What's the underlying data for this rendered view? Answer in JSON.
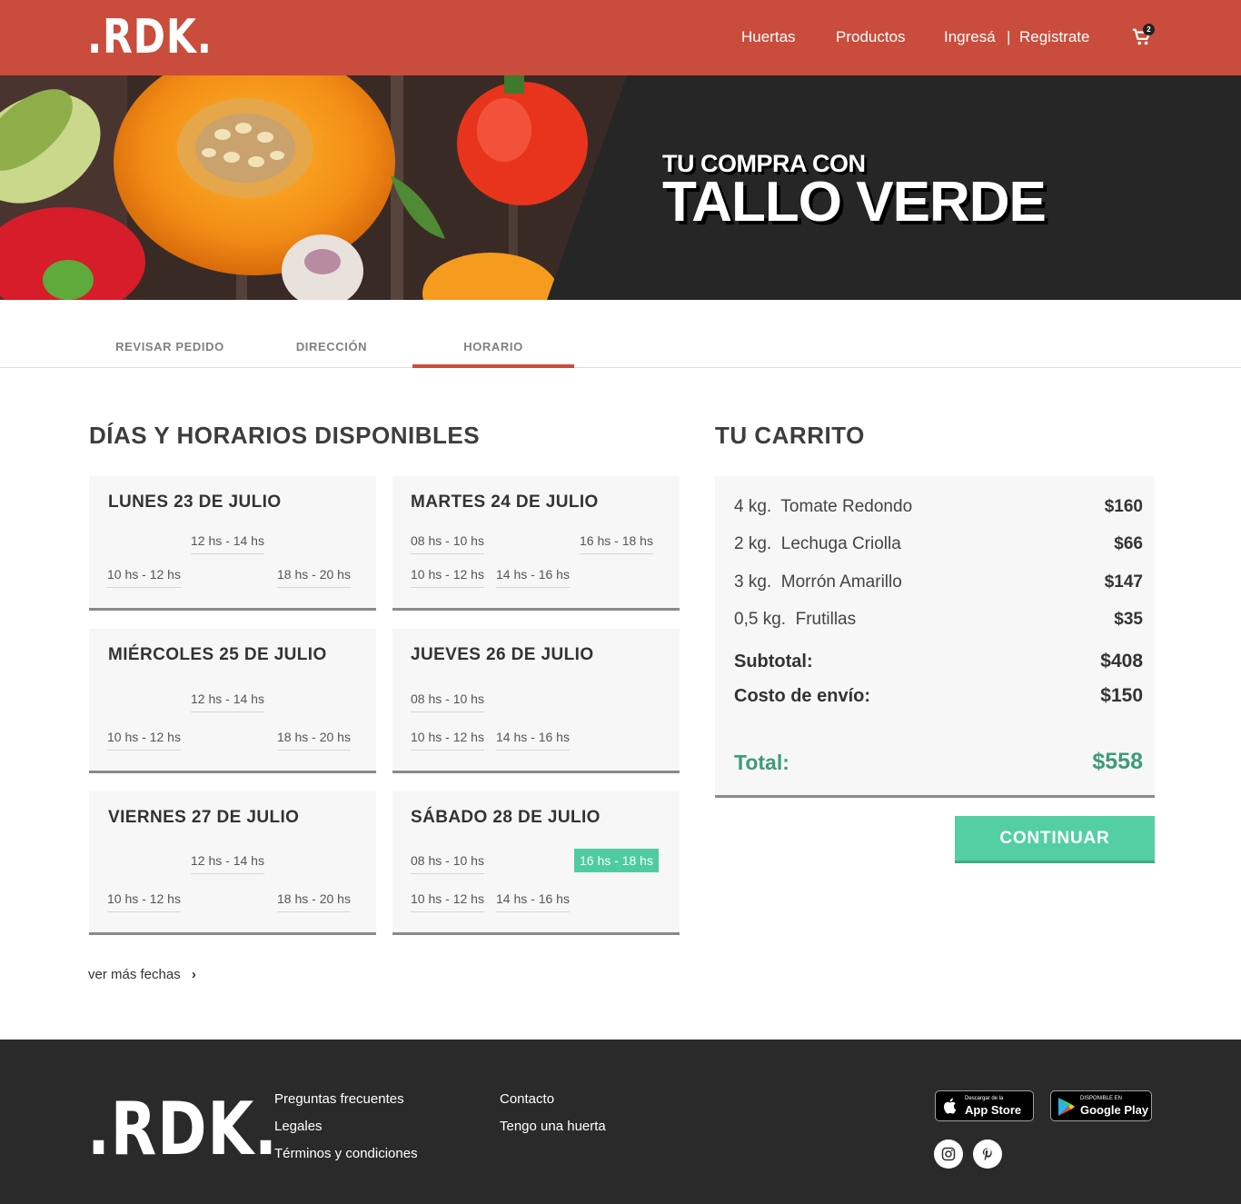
{
  "header": {
    "logo": ".RDK.",
    "nav": {
      "huertas": "Huertas",
      "productos": "Productos",
      "ingresa": "Ingresá",
      "separator": "|",
      "registrate": "Registrate"
    },
    "cart_count": "2",
    "cart_icon": "shopping-cart-icon"
  },
  "hero": {
    "subtitle": "TU COMPRA CON",
    "title": "TALLO VERDE"
  },
  "tabs": [
    {
      "label": "REVISAR PEDIDO"
    },
    {
      "label": "DIRECCIÓN"
    },
    {
      "label": "HORARIO",
      "active": true
    }
  ],
  "schedule": {
    "title": "DÍAS Y HORARIOS DISPONIBLES",
    "days": [
      {
        "title": "LUNES 23 DE JULIO",
        "slots": [
          "12 hs - 14 hs",
          "10 hs - 12 hs",
          "18 hs - 20 hs"
        ]
      },
      {
        "title": "MARTES 24 DE JULIO",
        "slots": [
          "08 hs - 10 hs",
          "16 hs - 18 hs",
          "10 hs - 12 hs",
          "14 hs - 16 hs"
        ]
      },
      {
        "title": "MIÉRCOLES 25 DE JULIO",
        "slots": [
          "12 hs - 14 hs",
          "10 hs - 12 hs",
          "18 hs - 20 hs"
        ]
      },
      {
        "title": "JUEVES 26 DE JULIO",
        "slots": [
          "08 hs - 10 hs",
          "10 hs - 12 hs",
          "14 hs - 16 hs"
        ]
      },
      {
        "title": "VIERNES 27 DE JULIO",
        "slots": [
          "12 hs - 14 hs",
          "10 hs - 12 hs",
          "18 hs - 20 hs"
        ]
      },
      {
        "title": "SÁBADO 28 DE JULIO",
        "slots": [
          "08 hs - 10 hs",
          "16 hs - 18 hs",
          "10 hs - 12 hs",
          "14 hs - 16 hs"
        ],
        "selected_slot": "16 hs - 18 hs"
      }
    ],
    "more_dates": "ver más fechas"
  },
  "cart": {
    "title": "TU CARRITO",
    "items": [
      {
        "qty": "4 kg.",
        "name": "Tomate Redondo",
        "price": "$160"
      },
      {
        "qty": "2 kg.",
        "name": "Lechuga Criolla",
        "price": "$66"
      },
      {
        "qty": "3 kg.",
        "name": "Morrón Amarillo",
        "price": "$147"
      },
      {
        "qty": "0,5 kg.",
        "name": "Frutillas",
        "price": "$35"
      }
    ],
    "subtotal_label": "Subtotal:",
    "subtotal": "$408",
    "shipping_label": "Costo de envío:",
    "shipping": "$150",
    "total_label": "Total:",
    "total": "$558",
    "continue_label": "CONTINUAR"
  },
  "footer": {
    "logo": ".RDK.",
    "links_col1": [
      "Preguntas frecuentes",
      "Legales",
      "Términos y condiciones"
    ],
    "links_col2": [
      "Contacto",
      "Tengo una huerta"
    ],
    "app_store": {
      "small": "Descargar de la",
      "big": "App Store"
    },
    "google_play": {
      "small": "DISPONIBLE EN",
      "big": "Google Play"
    },
    "social": [
      "instagram-icon",
      "pinterest-icon"
    ]
  },
  "colors": {
    "brand_red": "#c94c3c",
    "accent_green": "#53cfa3",
    "total_green": "#3f9a7c",
    "dark": "#2a2a2a"
  }
}
